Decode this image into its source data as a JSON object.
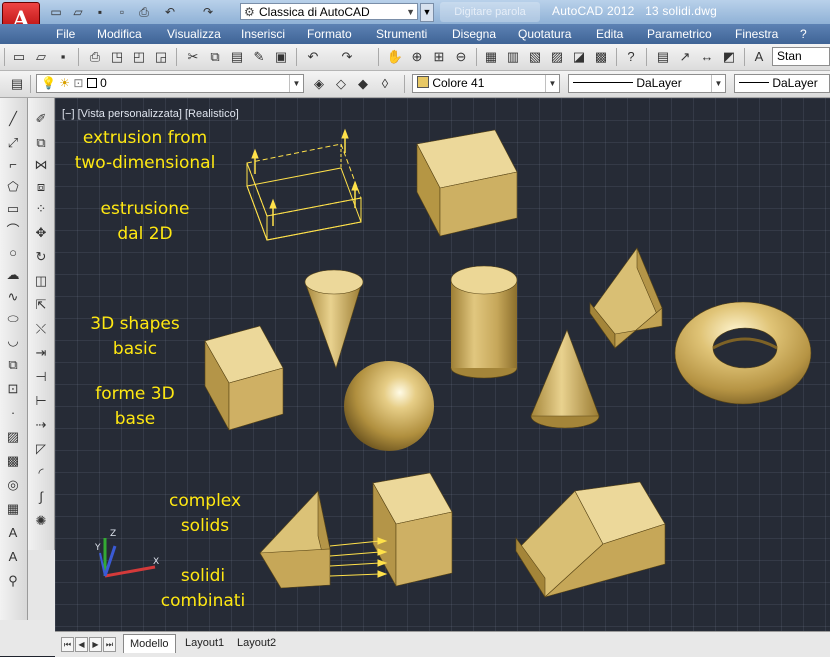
{
  "titlebar": {
    "workspace": "Classica di AutoCAD",
    "app_title": "AutoCAD 2012",
    "file_name": "13 solidi.dwg",
    "search_hint": "Digitare parola chiave o frase"
  },
  "menu": [
    "File",
    "Modifica",
    "Visualizza",
    "Inserisci",
    "Formato",
    "Strumenti",
    "Disegna",
    "Quotatura",
    "Edita",
    "Parametrico",
    "Finestra",
    "?"
  ],
  "toolbar": {
    "text_style": "Stan",
    "layer": "0",
    "color": "Colore 41",
    "linetype": "DaLayer",
    "lineweight": "DaLayer"
  },
  "viewport": {
    "label": "[−] [Vista personalizzata] [Realistico]",
    "annotations": {
      "extrusion_en": [
        "extrusion from",
        "two-dimensional"
      ],
      "extrusion_it": [
        "estrusione",
        "dal 2D"
      ],
      "basic_en": [
        "3D shapes",
        "basic"
      ],
      "basic_it": [
        "forme 3D",
        "base"
      ],
      "complex_en": [
        "complex",
        "solids"
      ],
      "complex_it": [
        "solidi",
        "combinati"
      ]
    },
    "text_color": "#ffe812",
    "solid_color": "#c9a95a"
  },
  "tabs": [
    "Modello",
    "Layout1",
    "Layout2"
  ],
  "active_tab": "Modello"
}
